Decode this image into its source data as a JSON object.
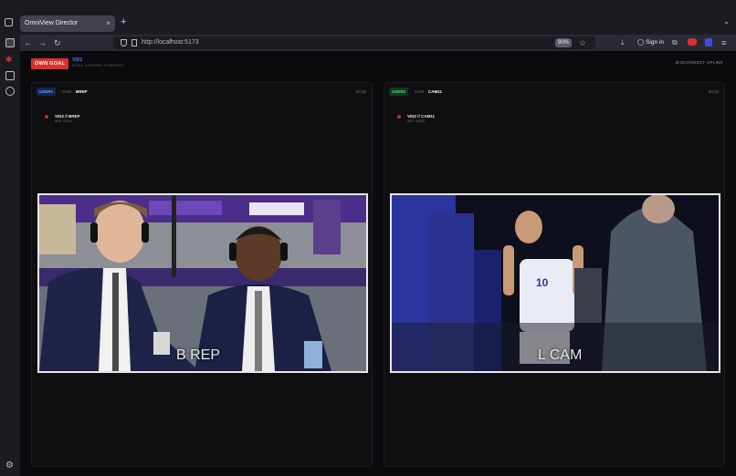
{
  "browser": {
    "tab_title": "OmniView Director",
    "tab_close": "×",
    "new_tab": "+",
    "url": "http://localhost:5173",
    "zoom": "90%",
    "signin": "Sign in",
    "back": "←",
    "forward": "→",
    "reload": "↻"
  },
  "header": {
    "logo": "OWN GOAL",
    "vid": "VID2",
    "subtitle": "DUAL VIEWER CONFIGS",
    "disconnect": "DISCONNECT UPLINK"
  },
  "panels": [
    {
      "badge": "USER1",
      "cam_label": "CAM",
      "cam_name": "BREP",
      "time": "00:32",
      "feed_title": "VID2 // BREP",
      "feed_sub": "SRC: 00001",
      "overlay": "B REP"
    },
    {
      "badge": "USER2",
      "cam_label": "CAM",
      "cam_name": "CAM11",
      "time": "00:32",
      "feed_title": "VID2 // CAM11",
      "feed_sub": "SRC: 00002",
      "overlay": "L CAM"
    }
  ],
  "colors": {
    "logo_red": "#d9312d",
    "user1_blue": "#60a5fa",
    "user2_green": "#4ade80",
    "court_purple": "#5b3a9a"
  }
}
